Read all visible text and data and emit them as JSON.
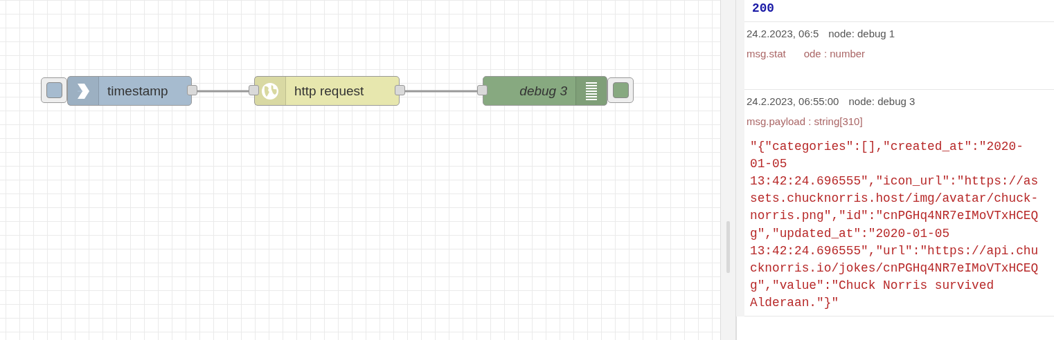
{
  "flow": {
    "nodes": [
      {
        "kind": "inject",
        "label": "timestamp",
        "color": "#a6bbcf"
      },
      {
        "kind": "http",
        "label": "http request",
        "color": "#e7e7ae"
      },
      {
        "kind": "debug",
        "label": "debug 3",
        "color": "#87a980"
      }
    ]
  },
  "debug_sidebar": {
    "messages": [
      {
        "value": "200",
        "kind": "number"
      },
      {
        "timestamp": "24.2.2023, 06:5",
        "node": "node: debug 1",
        "property": "msg.stat",
        "property_tail": "ode : number"
      },
      {
        "timestamp": "24.2.2023, 06:55:00",
        "node": "node: debug 3",
        "property": "msg.payload : string[310]",
        "value": "\"{\"categories\":[],\"created_at\":\"2020-01-05 13:42:24.696555\",\"icon_url\":\"https://assets.chucknorris.host/img/avatar/chuck-norris.png\",\"id\":\"cnPGHq4NR7eIMoVTxHCEQg\",\"updated_at\":\"2020-01-05 13:42:24.696555\",\"url\":\"https://api.chucknorris.io/jokes/cnPGHq4NR7eIMoVTxHCEQg\",\"value\":\"Chuck Norris survived Alderaan.\"}\"",
        "kind": "string"
      }
    ]
  }
}
